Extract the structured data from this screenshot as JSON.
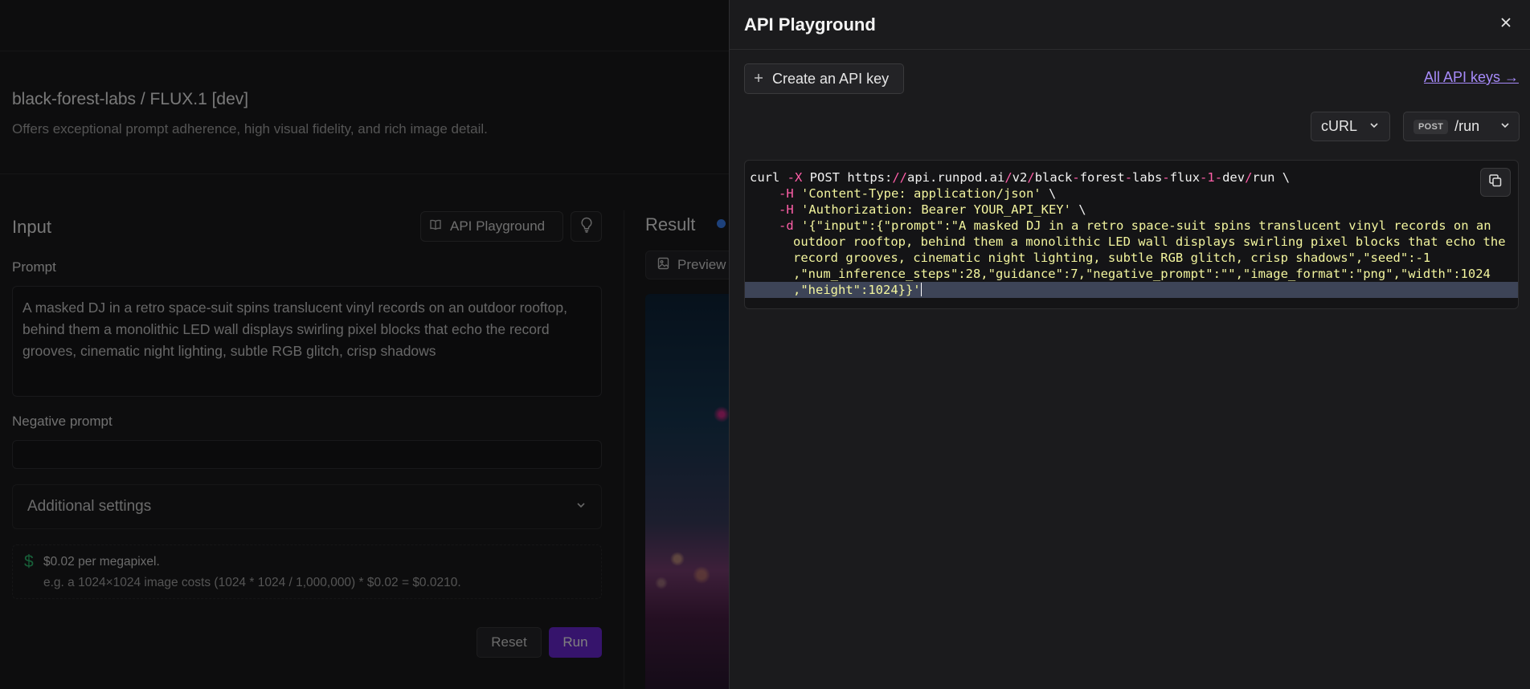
{
  "background": {
    "model": {
      "title": "black-forest-labs / FLUX.1 [dev]",
      "description": "Offers exceptional prompt adherence, high visual fidelity, and rich image detail."
    },
    "input": {
      "title": "Input",
      "api_playground_label": "API Playground",
      "prompt_label": "Prompt",
      "prompt_value": "A masked DJ in a retro space-suit spins translucent vinyl records on an outdoor rooftop, behind them a monolithic LED wall displays swirling pixel blocks that echo the record grooves, cinematic night lighting, subtle RGB glitch, crisp shadows",
      "negative_prompt_label": "Negative prompt",
      "negative_prompt_value": "",
      "additional_settings_label": "Additional settings",
      "pricing_line1": "$0.02 per megapixel.",
      "pricing_line2": "e.g. a 1024×1024 image costs (1024 * 1024 / 1,000,000) * $0.02 = $0.0210.",
      "reset_label": "Reset",
      "run_label": "Run"
    },
    "result": {
      "title": "Result",
      "preview_tab_label": "Preview"
    }
  },
  "drawer": {
    "title": "API Playground",
    "create_key_label": "Create an API key",
    "all_keys_label": "All API keys →",
    "language": "cURL",
    "method": "POST",
    "endpoint": "/run",
    "code": {
      "l1_cmd": "curl ",
      "l1_flag": "-X",
      "l1_method": " POST https:",
      "l1_sl1": "//",
      "l1_host": "api.runpod.ai",
      "l1_sl2": "/",
      "l1_ver": "v2",
      "l1_sl3": "/",
      "l1_p1": "black",
      "l1_d1": "-",
      "l1_p2": "forest",
      "l1_d2": "-",
      "l1_p3": "labs",
      "l1_d3": "-",
      "l1_p4": "flux",
      "l1_d4": "-",
      "l1_num": "1",
      "l1_d5": "-",
      "l1_p5": "dev",
      "l1_sl4": "/",
      "l1_run": "run \\",
      "l2_flag": "-H",
      "l2_str": "'Content-Type: application/json'",
      "l2_bs": " \\",
      "l3_flag": "-H",
      "l3_str": "'Authorization: Bearer YOUR_API_KEY'",
      "l3_bs": " \\",
      "l4_flag": "-d",
      "l4_str": "'{\"input\":{\"prompt\":\"A masked DJ in a retro space-suit spins translucent vinyl records on an",
      "l5_str": "outdoor rooftop, behind them a monolithic LED wall displays swirling pixel blocks that echo the",
      "l6_str": "record grooves, cinematic night lighting, subtle RGB glitch, crisp shadows\",\"seed\":-1",
      "l7_str": ",\"num_inference_steps\":28,\"guidance\":7,\"negative_prompt\":\"\",\"image_format\":\"png\",\"width\":1024",
      "l8_str": ",\"height\":1024}}'"
    }
  },
  "icons": {
    "close": "x-icon",
    "plus": "plus-icon",
    "chevron": "chevron-down-icon",
    "copy": "copy-icon",
    "book": "book-icon",
    "bulb": "lightbulb-icon",
    "image": "image-icon",
    "dollar": "dollar-icon"
  },
  "colors": {
    "accent": "#6d28d9",
    "link": "#a78bfa",
    "code_string": "#f3f59e",
    "code_punct": "#ff5fa8",
    "status_dot": "#3b82f6",
    "price_icon": "#2fbf71"
  }
}
